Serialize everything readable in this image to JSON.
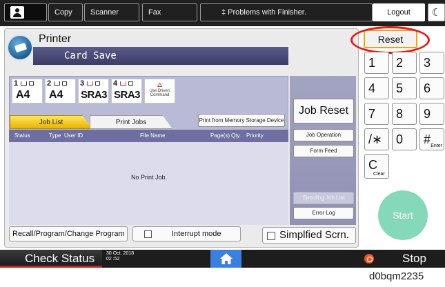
{
  "topbar": {
    "copy": "Copy",
    "scanner": "Scanner",
    "fax": "Fax",
    "problems": "‡ Problems with Finisher.",
    "logout": "Logout",
    "moon": "☾"
  },
  "app": {
    "title": "Printer",
    "subtitle": "Card Save"
  },
  "trays": [
    {
      "num": "1",
      "size": "A4"
    },
    {
      "num": "2",
      "size": "A4"
    },
    {
      "num": "3",
      "size": "SRA3"
    },
    {
      "num": "4",
      "size": "SRA3"
    }
  ],
  "driver": {
    "line1": "Use Driver/",
    "line2": "Command"
  },
  "tabs": {
    "job_list": "Job List",
    "print_jobs": "Print Jobs"
  },
  "memory_button": "Print from Memory Storage Device",
  "columns": {
    "status": "Status",
    "type": "Type",
    "user_id": "User ID",
    "file_name": "File Name",
    "pages": "Page(s)",
    "qty": "Qty.",
    "priority": "Priority"
  },
  "no_job": "No Print Job.",
  "side": {
    "job_reset": "Job Reset",
    "job_operation": "Job Operation",
    "form_feed": "Form Feed",
    "spooling": "Spooling Job List",
    "error_log": "Error Log"
  },
  "bottom": {
    "recall": "Recall/Program/Change Program",
    "interrupt": "Interrupt mode",
    "simplified": "Simplfied Scrn."
  },
  "keypad": {
    "reset": "Reset",
    "k1": "1",
    "k2": "2",
    "k3": "3",
    "k4": "4",
    "k5": "5",
    "k6": "6",
    "k7": "7",
    "k8": "8",
    "k9": "9",
    "kstar": "/∗",
    "k0": "0",
    "khash": "#",
    "khash_sub": "Enter",
    "kclear": "C",
    "kclear_sub": "Clear",
    "start": "Start"
  },
  "status": {
    "check": "Check Status",
    "date": "30 Oct. 2018",
    "time": "02 :52",
    "stop": "Stop"
  },
  "caption": "d0bqm2235",
  "colors": {
    "accent_reset": "#f0a500",
    "annotation_ring": "#e21b1b",
    "start": "#86d8ba",
    "home": "#3b7fe0"
  }
}
